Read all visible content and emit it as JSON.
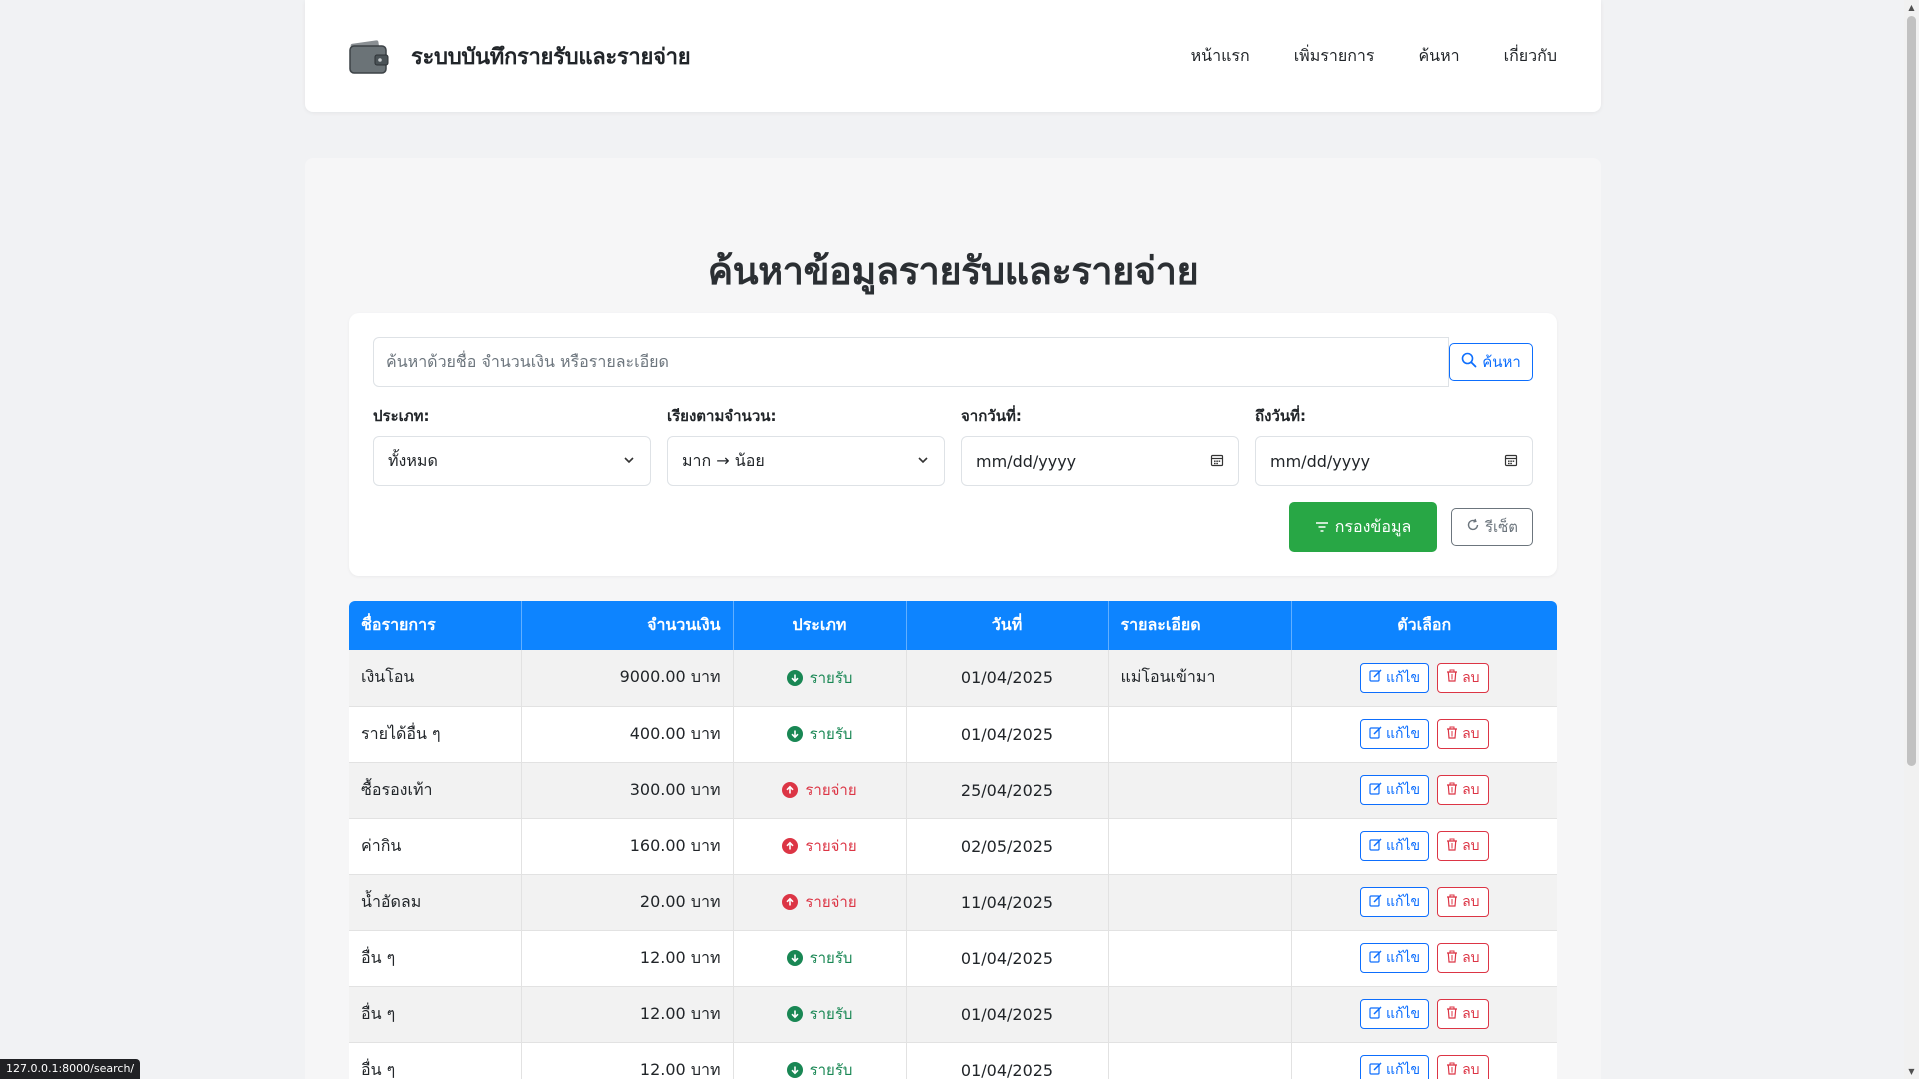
{
  "brand": {
    "title": "ระบบบันทึกรายรับและรายจ่าย"
  },
  "nav": [
    "หน้าแรก",
    "เพิ่มรายการ",
    "ค้นหา",
    "เกี่ยวกับ"
  ],
  "page": {
    "title": "ค้นหาข้อมูลรายรับและรายจ่าย"
  },
  "search": {
    "placeholder": "ค้นหาด้วยชื่อ จำนวนเงิน หรือรายละเอียด",
    "button": "ค้นหา"
  },
  "filters": {
    "type_label": "ประเภท:",
    "type_value": "ทั้งหมด",
    "sort_label": "เรียงตามจำนวน:",
    "sort_value": "มาก → น้อย",
    "from_label": "จากวันที่:",
    "from_value": "mm/dd/yyyy",
    "to_label": "ถึงวันที่:",
    "to_value": "mm/dd/yyyy",
    "filter_button": "กรองข้อมูล",
    "reset_button": "รีเซ็ต"
  },
  "table": {
    "headers": [
      "ชื่อรายการ",
      "จำนวนเงิน",
      "ประเภท",
      "วันที่",
      "รายละเอียด",
      "ตัวเลือก"
    ],
    "edit_label": "แก้ไข",
    "delete_label": "ลบ",
    "rows": [
      {
        "name": "เงินโอน",
        "amount": "9000.00 บาท",
        "type": "income",
        "type_label": "รายรับ",
        "date": "01/04/2025",
        "desc": "แม่โอนเข้ามา"
      },
      {
        "name": "รายได้อื่น ๆ",
        "amount": "400.00 บาท",
        "type": "income",
        "type_label": "รายรับ",
        "date": "01/04/2025",
        "desc": ""
      },
      {
        "name": "ซื้อรองเท้า",
        "amount": "300.00 บาท",
        "type": "expense",
        "type_label": "รายจ่าย",
        "date": "25/04/2025",
        "desc": ""
      },
      {
        "name": "ค่ากิน",
        "amount": "160.00 บาท",
        "type": "expense",
        "type_label": "รายจ่าย",
        "date": "02/05/2025",
        "desc": ""
      },
      {
        "name": "น้ำอัดลม",
        "amount": "20.00 บาท",
        "type": "expense",
        "type_label": "รายจ่าย",
        "date": "11/04/2025",
        "desc": ""
      },
      {
        "name": "อื่น ๆ",
        "amount": "12.00 บาท",
        "type": "income",
        "type_label": "รายรับ",
        "date": "01/04/2025",
        "desc": ""
      },
      {
        "name": "อื่น ๆ",
        "amount": "12.00 บาท",
        "type": "income",
        "type_label": "รายรับ",
        "date": "01/04/2025",
        "desc": ""
      },
      {
        "name": "อื่น ๆ",
        "amount": "12.00 บาท",
        "type": "income",
        "type_label": "รายรับ",
        "date": "01/04/2025",
        "desc": ""
      }
    ]
  },
  "status_url": "127.0.0.1:8000/search/",
  "colors": {
    "primary": "#0d84ff",
    "success": "#28a745",
    "income": "#198754",
    "expense": "#dc3545"
  }
}
